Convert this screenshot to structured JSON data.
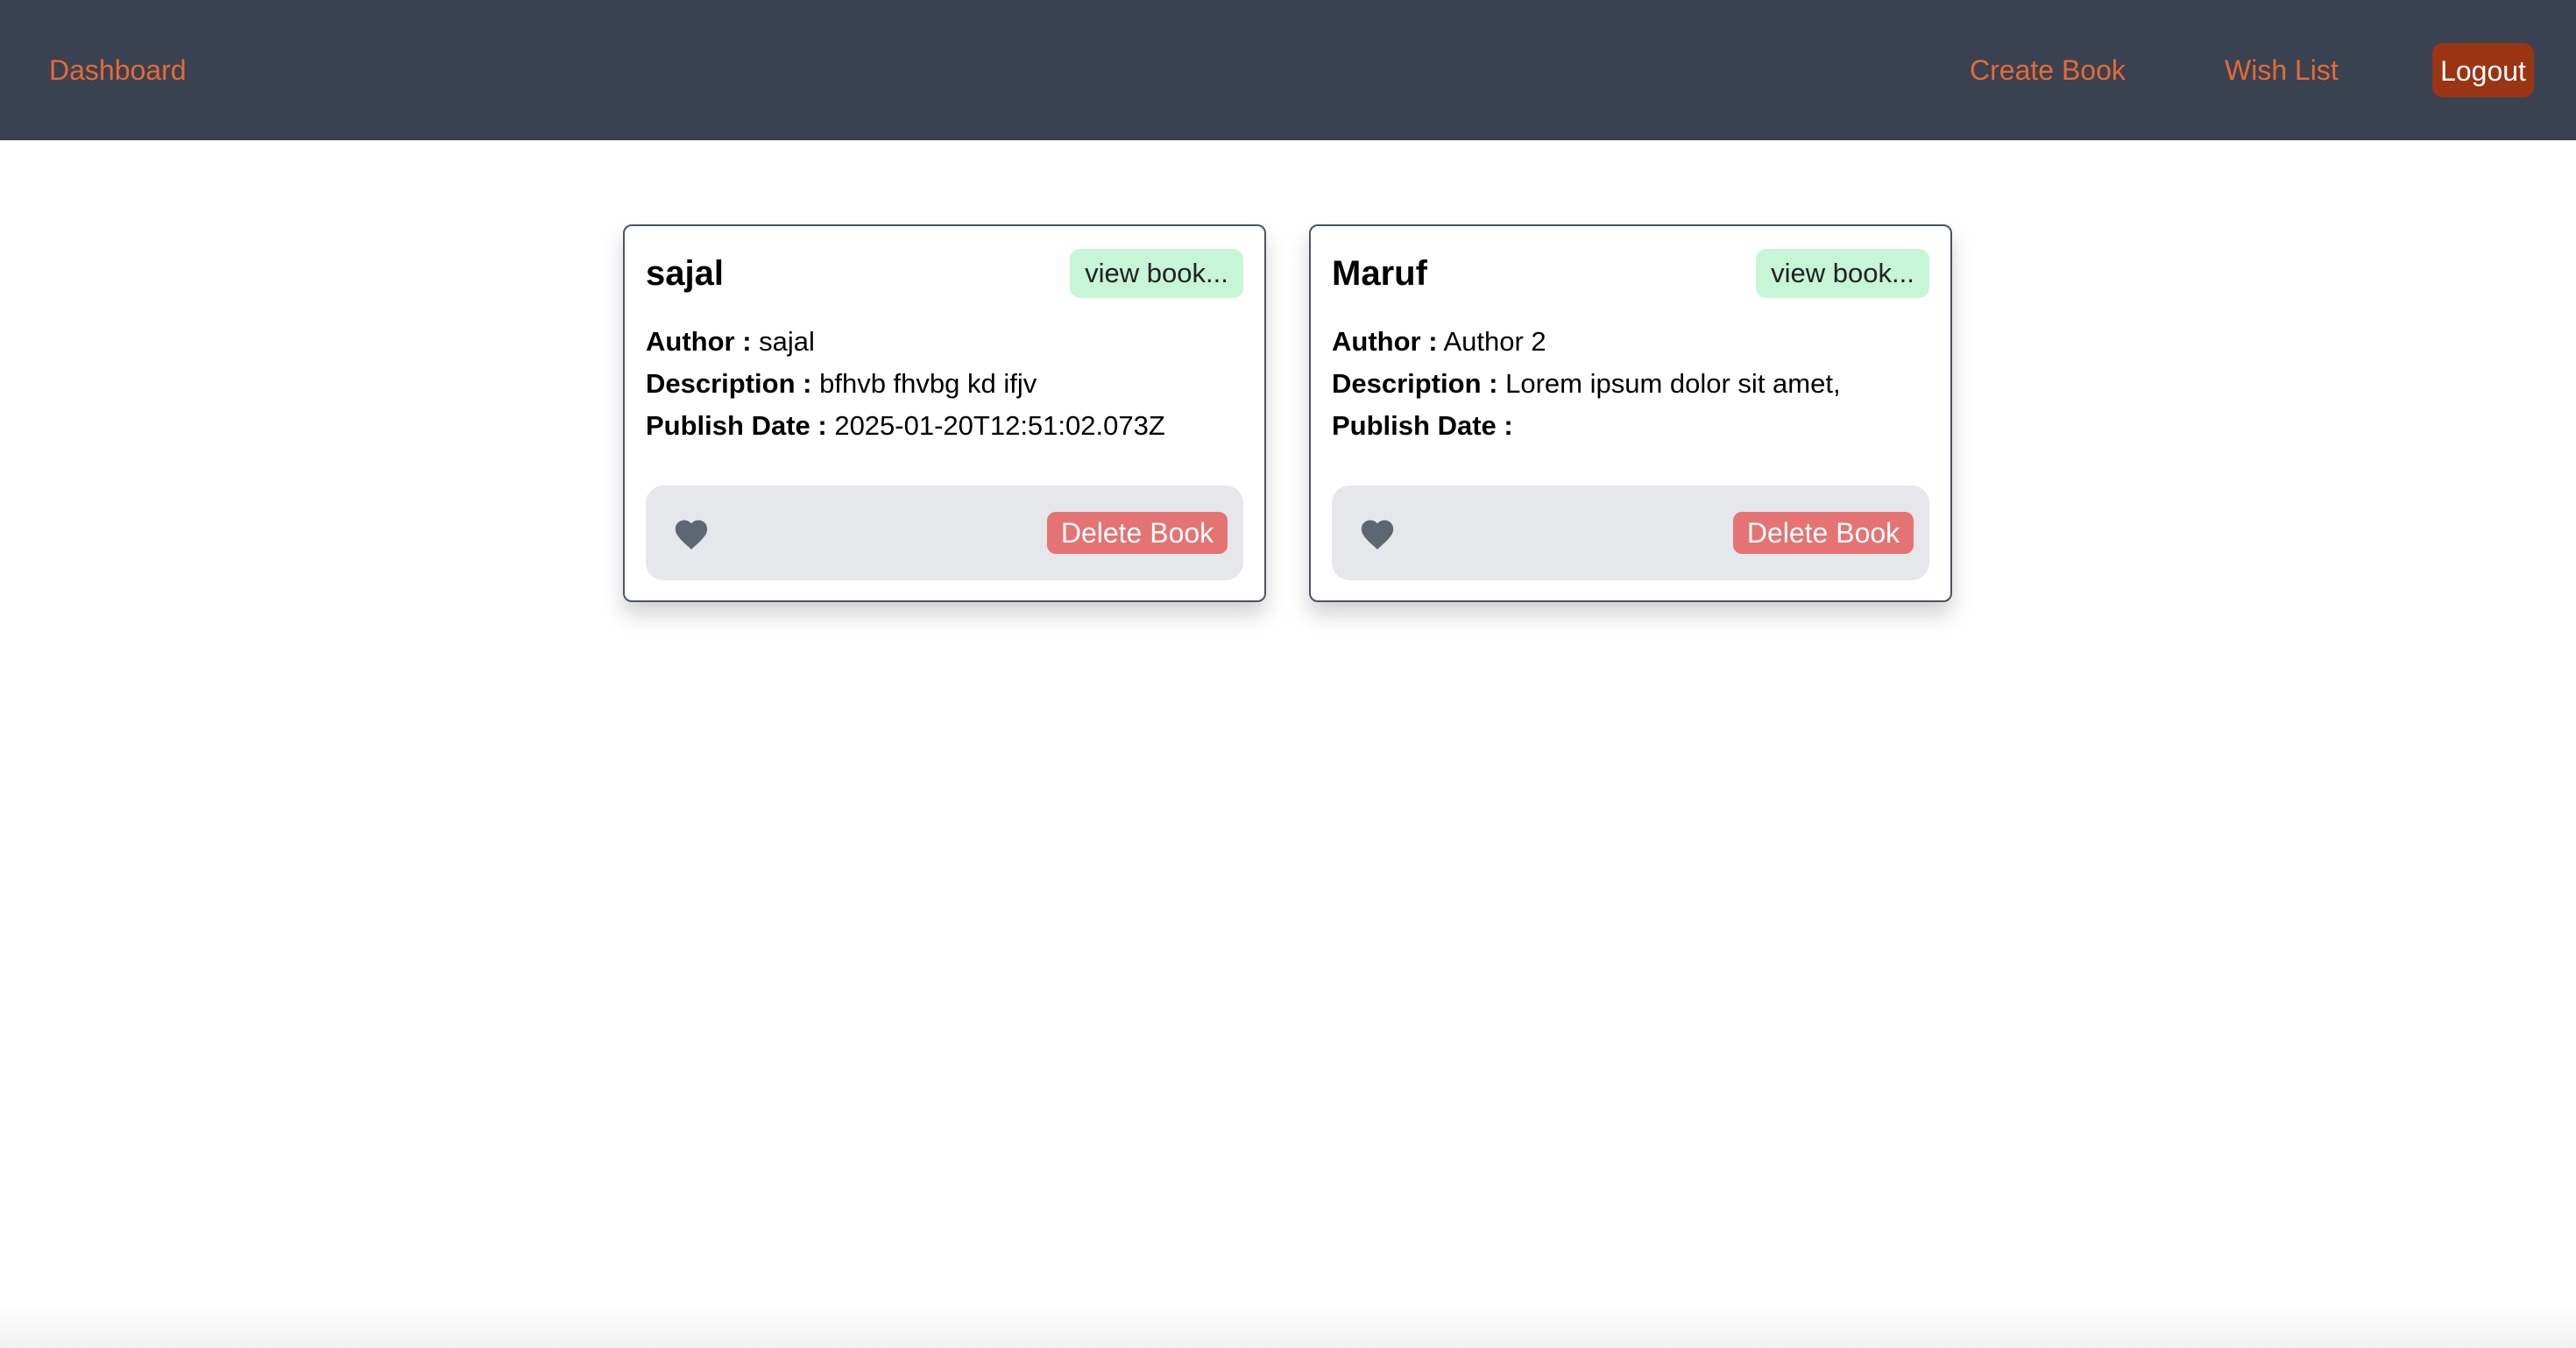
{
  "nav": {
    "dashboard": "Dashboard",
    "create_book": "Create Book",
    "wish_list": "Wish List",
    "logout": "Logout"
  },
  "labels": {
    "author": "Author :",
    "description": "Description :",
    "publish_date": "Publish Date :",
    "view_book": "view book...",
    "delete_book": "Delete Book"
  },
  "books": [
    {
      "title": "sajal",
      "author": "sajal",
      "description": "bfhvb fhvbg kd ifjv",
      "publish_date": "2025-01-20T12:51:02.073Z"
    },
    {
      "title": "Maruf",
      "author": "Author 2",
      "description": "Lorem ipsum dolor sit amet,",
      "publish_date": ""
    }
  ],
  "icons": {
    "wishlist": "heart-icon"
  },
  "colors": {
    "navbar_bg": "#3a4150",
    "nav_link": "#e46b35",
    "logout_bg": "#9a3412",
    "view_btn_bg": "#c6f6d5",
    "delete_btn_bg": "#e57373",
    "footer_bg": "#e5e7eb",
    "heart": "#5f6673"
  }
}
